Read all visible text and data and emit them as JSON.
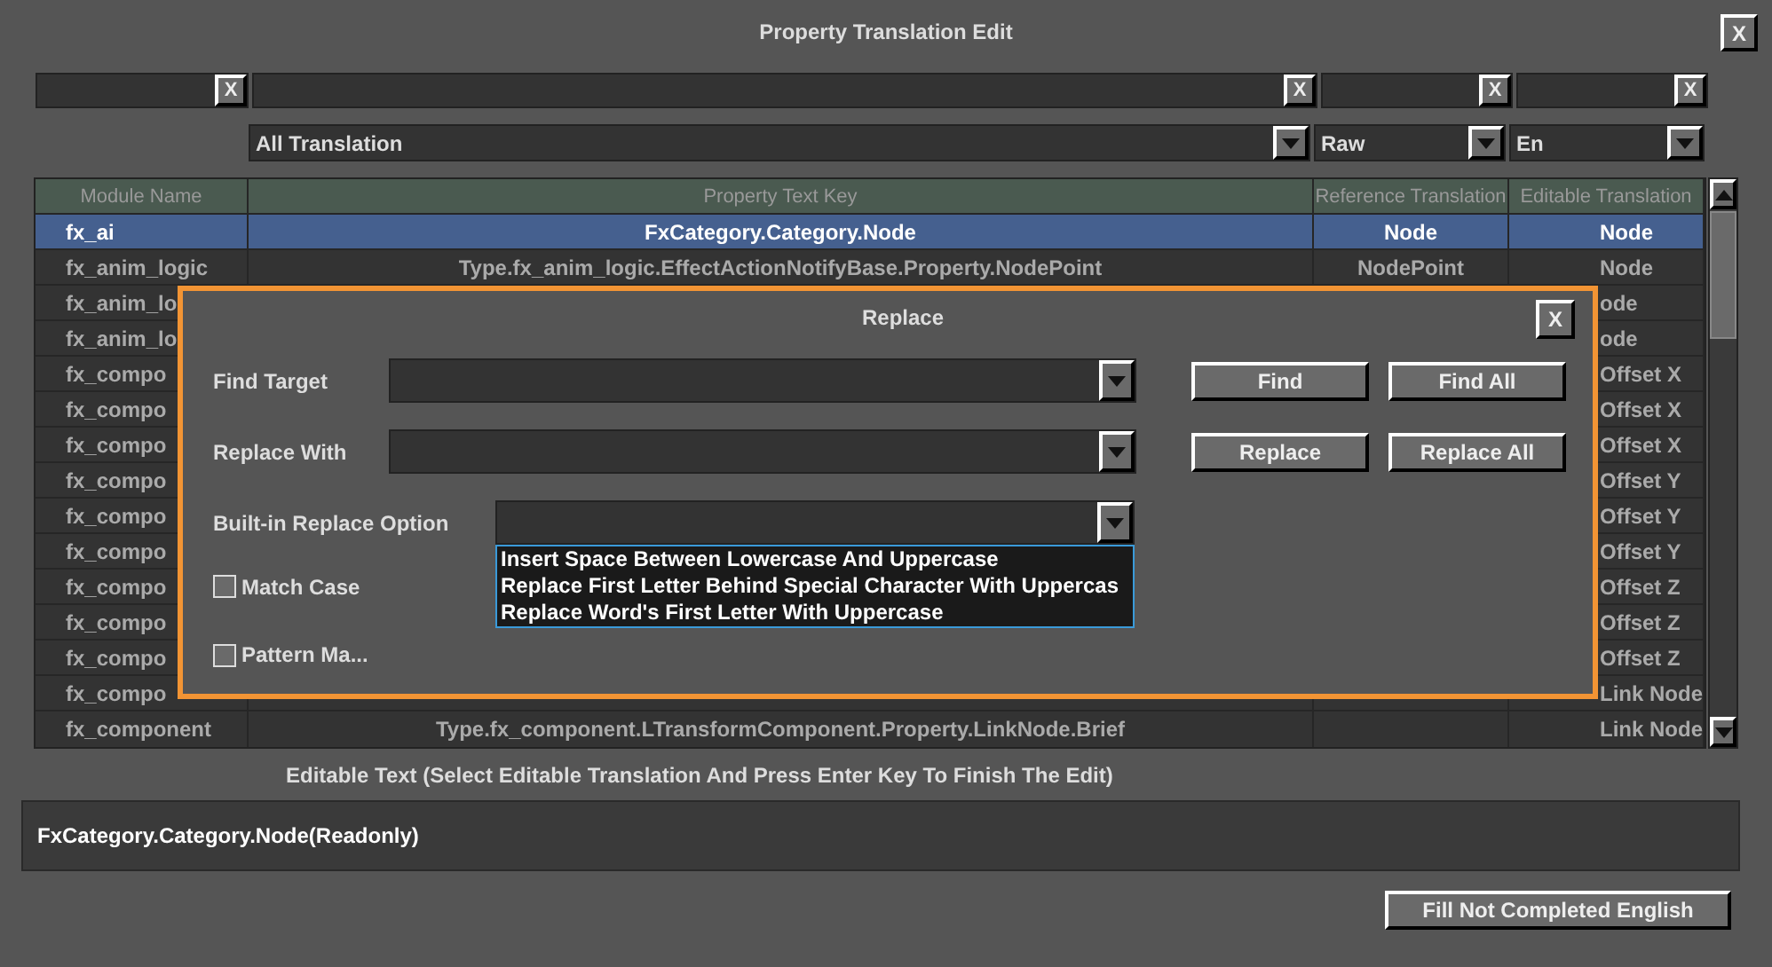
{
  "window": {
    "title": "Property Translation Edit",
    "close": "X"
  },
  "filters": [
    {
      "clear": "X"
    },
    {
      "clear": "X"
    },
    {
      "clear": "X"
    },
    {
      "clear": "X"
    }
  ],
  "selectors": [
    {
      "value": "All Translation"
    },
    {
      "value": "Raw"
    },
    {
      "value": "En"
    }
  ],
  "table": {
    "columns": [
      "Module Name",
      "Property Text Key",
      "Reference Translation",
      "Editable Translation"
    ],
    "rows": [
      {
        "module": "fx_ai",
        "key": "FxCategory.Category.Node",
        "reference": "Node",
        "editable": "Node",
        "selected": true
      },
      {
        "module": "fx_anim_logic",
        "key": "Type.fx_anim_logic.EffectActionNotifyBase.Property.NodePoint",
        "reference": "NodePoint",
        "editable": "Node",
        "selected": false
      },
      {
        "module": "fx_anim_lo",
        "editable": "ode",
        "selected": false
      },
      {
        "module": "fx_anim_lo",
        "editable": "ode",
        "selected": false
      },
      {
        "module": "fx_compo",
        "editable": "Offset X",
        "selected": false
      },
      {
        "module": "fx_compo",
        "editable": "Offset X",
        "selected": false
      },
      {
        "module": "fx_compo",
        "editable": "Offset X",
        "selected": false
      },
      {
        "module": "fx_compo",
        "editable": "Offset Y",
        "selected": false
      },
      {
        "module": "fx_compo",
        "editable": "Offset Y",
        "selected": false
      },
      {
        "module": "fx_compo",
        "editable": "Offset Y",
        "selected": false
      },
      {
        "module": "fx_compo",
        "editable": "Offset Z",
        "selected": false
      },
      {
        "module": "fx_compo",
        "editable": "Offset Z",
        "selected": false
      },
      {
        "module": "fx_compo",
        "editable": "Offset Z",
        "selected": false
      },
      {
        "module": "fx_compo",
        "editable": "Link Node",
        "selected": false
      },
      {
        "module": "fx_component",
        "key": "Type.fx_component.LTransformComponent.Property.LinkNode.Brief",
        "editable": "Link Node",
        "selected": false
      }
    ]
  },
  "editable_text": {
    "label": "Editable Text (Select Editable Translation And Press Enter Key To Finish The Edit)",
    "value": "FxCategory.Category.Node(Readonly)"
  },
  "footer_button": "Fill Not Completed English",
  "dialog": {
    "title": "Replace",
    "close": "X",
    "fields": [
      {
        "label": "Find Target"
      },
      {
        "label": "Replace With"
      }
    ],
    "option": {
      "label": "Built-in Replace Option",
      "list": [
        "Insert Space Between Lowercase And Uppercase",
        "Replace First Letter Behind Special Character With Uppercas",
        "Replace Word's First Letter With Uppercase"
      ]
    },
    "buttons": [
      "Find",
      "Find All",
      "Replace",
      "Replace All"
    ],
    "checkboxes": [
      {
        "label": "Match Case",
        "checked": false
      },
      {
        "label": "Pattern Ma...",
        "checked": false
      }
    ]
  }
}
